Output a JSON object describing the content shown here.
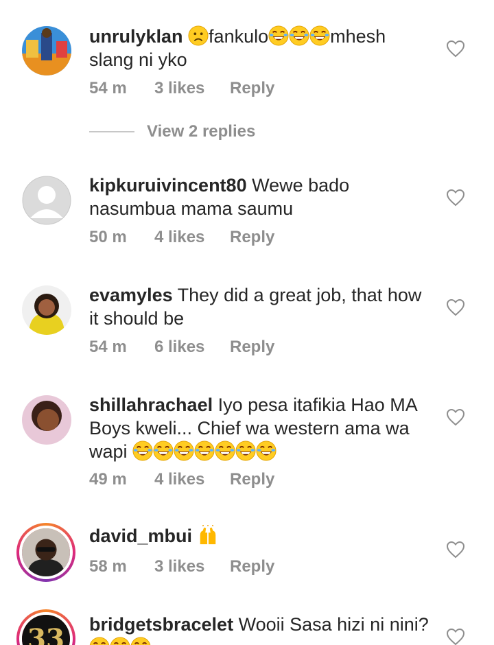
{
  "comments": [
    {
      "username": "unrulyklan",
      "text_a": "fankulo",
      "text_b": "mhesh slang ni yko",
      "time": "54 m",
      "likes": "3 likes",
      "reply": "Reply"
    },
    {
      "username": "kipkuruivincent80",
      "text": "Wewe bado nasumbua mama saumu",
      "time": "50 m",
      "likes": "4 likes",
      "reply": "Reply"
    },
    {
      "username": "evamyles",
      "text": "They did a great job, that how it should be",
      "time": "54 m",
      "likes": "6 likes",
      "reply": "Reply"
    },
    {
      "username": "shillahrachael",
      "text": "Iyo pesa itafikia Hao MA Boys kweli... Chief wa western ama wa wapi",
      "time": "49 m",
      "likes": "4 likes",
      "reply": "Reply"
    },
    {
      "username": "david_mbui",
      "text": "",
      "time": "58 m",
      "likes": "3 likes",
      "reply": "Reply"
    },
    {
      "username": "bridgetsbracelet",
      "text": "Wooii Sasa hizi ni nini?",
      "time": "",
      "likes": "",
      "reply": ""
    }
  ],
  "view_replies": "View 2 replies",
  "icons": {
    "heart": "heart-outline-icon",
    "laugh": "tears-of-joy-emoji",
    "sad": "frowning-face-emoji",
    "hands": "raising-hands-emoji"
  }
}
